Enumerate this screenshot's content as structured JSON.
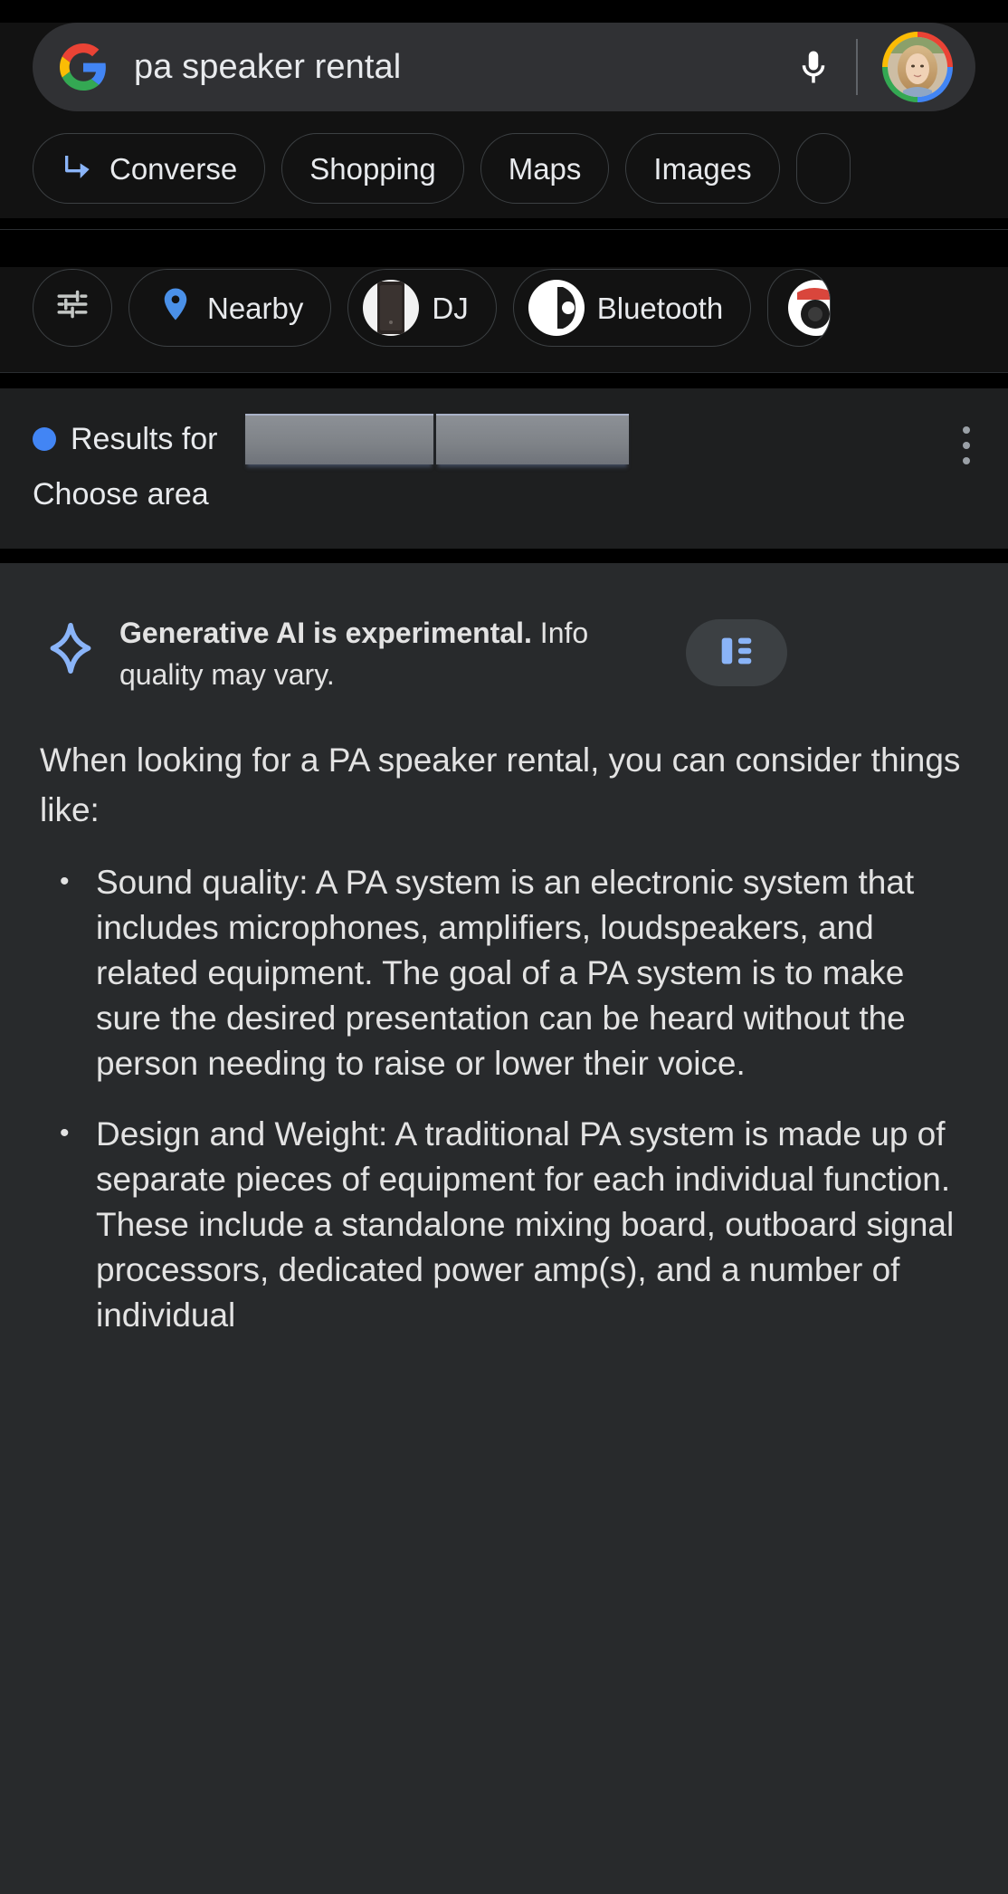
{
  "search": {
    "query": "pa speaker rental",
    "logo": "google-logo",
    "mic_icon": "microphone-icon",
    "avatar": "account-avatar"
  },
  "tabs": [
    {
      "label": "Converse",
      "icon": "subdirectory-arrow-icon"
    },
    {
      "label": "Shopping",
      "icon": ""
    },
    {
      "label": "Maps",
      "icon": ""
    },
    {
      "label": "Images",
      "icon": ""
    },
    {
      "label": "",
      "icon": ""
    }
  ],
  "filters": {
    "tune_icon": "tune-sliders-icon",
    "chips": [
      {
        "label": "Nearby",
        "icon": "location-pin-icon",
        "thumb": ""
      },
      {
        "label": "DJ",
        "icon": "",
        "thumb": "dj-speaker-thumbnail"
      },
      {
        "label": "Bluetooth",
        "icon": "",
        "thumb": "bluetooth-speaker-thumbnail"
      },
      {
        "label": "",
        "icon": "",
        "thumb": "red-speaker-thumbnail"
      }
    ]
  },
  "results_for": {
    "dot_color": "#4285f4",
    "prefix": "Results for",
    "location_redacted": true,
    "choose_area": "Choose area",
    "overflow_icon": "kebab-menu-icon"
  },
  "ai_panel": {
    "spark_icon": "generative-ai-spark-icon",
    "disclaimer_bold": "Generative AI is experimental.",
    "disclaimer_rest": " Info quality may vary.",
    "list_view_icon": "list-view-icon",
    "intro": "When looking for a PA speaker rental, you can consider things like:",
    "bullets": [
      "Sound quality: A PA system is an electronic system that includes microphones, amplifiers, loudspeakers, and related equipment. The goal of a PA system is to make sure the desired presentation can be heard without the person needing to raise or lower their voice.",
      "Design and Weight: A traditional PA system is made up of separate pieces of equipment for each individual function. These include a standalone mixing board, outboard signal processors, dedicated power amp(s), and a number of individual"
    ],
    "bullet_glyph": "•"
  },
  "colors": {
    "page_bg": "#000000",
    "top_bg": "#121212",
    "searchbar_bg": "#303134",
    "panel_bg": "#282a2c",
    "results_bar_bg": "#1e1f20",
    "accent_blue": "#4285f4",
    "spark_blue": "#8ab4f8",
    "text": "#e8eaed"
  }
}
